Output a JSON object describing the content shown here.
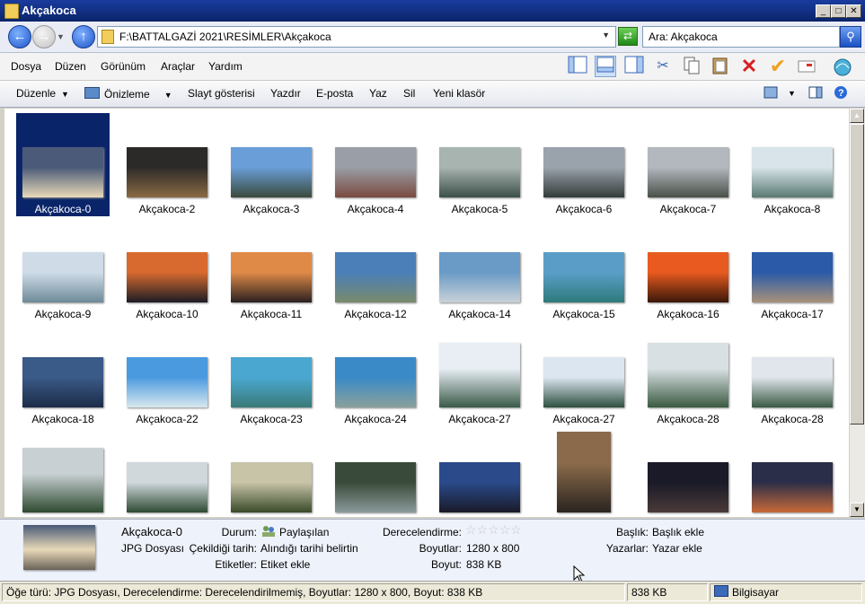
{
  "window": {
    "title": "Akçakoca"
  },
  "address": {
    "path": "F:\\BATTALGAZİ 2021\\RESİMLER\\Akçakoca",
    "search": "Ara: Akçakoca"
  },
  "menu": [
    "Dosya",
    "Düzen",
    "Görünüm",
    "Araçlar",
    "Yardım"
  ],
  "commands": {
    "organize": "Düzenle",
    "preview": "Önizleme",
    "slideshow": "Slayt gösterisi",
    "print": "Yazdır",
    "email": "E-posta",
    "burn": "Yaz",
    "delete": "Sil",
    "newfolder": "Yeni klasör"
  },
  "files": [
    {
      "name": "Akçakoca-0",
      "c1": "#4a5a78",
      "c2": "#e8d9b8",
      "selected": true
    },
    {
      "name": "Akçakoca-2",
      "c1": "#2c2a28",
      "c2": "#8a6a44"
    },
    {
      "name": "Akçakoca-3",
      "c1": "#6a9ed8",
      "c2": "#3a4a3c"
    },
    {
      "name": "Akçakoca-4",
      "c1": "#9a9ea6",
      "c2": "#7a4a40"
    },
    {
      "name": "Akçakoca-5",
      "c1": "#a8b4b0",
      "c2": "#3c5048"
    },
    {
      "name": "Akçakoca-6",
      "c1": "#9aa2ac",
      "c2": "#343c3a"
    },
    {
      "name": "Akçakoca-7",
      "c1": "#b2b8be",
      "c2": "#4a5048"
    },
    {
      "name": "Akçakoca-8",
      "c1": "#d8e4ea",
      "c2": "#5a7a72"
    },
    {
      "name": "Akçakoca-9",
      "c1": "#cfdce8",
      "c2": "#6e8a98"
    },
    {
      "name": "Akçakoca-10",
      "c1": "#d86a30",
      "c2": "#1c1c24"
    },
    {
      "name": "Akçakoca-11",
      "c1": "#e08a48",
      "c2": "#2a2020"
    },
    {
      "name": "Akçakoca-12",
      "c1": "#4a7fb8",
      "c2": "#7a8a6c"
    },
    {
      "name": "Akçakoca-14",
      "c1": "#6a9ac6",
      "c2": "#c8d2d8"
    },
    {
      "name": "Akçakoca-15",
      "c1": "#5a9ec8",
      "c2": "#2e7a7a"
    },
    {
      "name": "Akçakoca-16",
      "c1": "#e85a20",
      "c2": "#3a1808"
    },
    {
      "name": "Akçakoca-17",
      "c1": "#2a5aa8",
      "c2": "#a8927a"
    },
    {
      "name": "Akçakoca-18",
      "c1": "#3a5a88",
      "c2": "#1c2c48"
    },
    {
      "name": "Akçakoca-22",
      "c1": "#4a9ae0",
      "c2": "#d8e8ee"
    },
    {
      "name": "Akçakoca-23",
      "c1": "#4aa8d0",
      "c2": "#3a7a78"
    },
    {
      "name": "Akçakoca-24",
      "c1": "#3a8ac8",
      "c2": "#8aa09a"
    },
    {
      "name": "Akçakoca-27",
      "c1": "#e8eef4",
      "c2": "#3a5a48",
      "tall": true
    },
    {
      "name": "Akçakoca-27",
      "c1": "#dce6f0",
      "c2": "#2e5040"
    },
    {
      "name": "Akçakoca-28",
      "c1": "#d8e0e4",
      "c2": "#3a5a40",
      "tall": true
    },
    {
      "name": "Akçakoca-28",
      "c1": "#e0e6ec",
      "c2": "#3a5a44"
    },
    {
      "name": "",
      "c1": "#c8d0d4",
      "c2": "#2e4a30",
      "tall": true
    },
    {
      "name": "",
      "c1": "#d0d8dc",
      "c2": "#2e4a34"
    },
    {
      "name": "",
      "c1": "#c8c4a8",
      "c2": "#3a4a2a"
    },
    {
      "name": "",
      "c1": "#3a4a3a",
      "c2": "#8a9a9a"
    },
    {
      "name": "",
      "c1": "#2a4a8a",
      "c2": "#1a1a28"
    },
    {
      "name": "",
      "c1": "#8a6a4a",
      "c2": "#2a2420",
      "xtall": true
    },
    {
      "name": "",
      "c1": "#1a1a28",
      "c2": "#4a3a38"
    },
    {
      "name": "",
      "c1": "#2a2e48",
      "c2": "#c86a38"
    }
  ],
  "details": {
    "name": "Akçakoca-0",
    "type": "JPG Dosyası",
    "status_label": "Durum:",
    "status_value": "Paylaşılan",
    "date_label": "Çekildiği tarih:",
    "date_value": "Alındığı tarihi belirtin",
    "tags_label": "Etiketler:",
    "tags_value": "Etiket ekle",
    "rating_label": "Derecelendirme:",
    "dims_label": "Boyutlar:",
    "dims_value": "1280 x 800",
    "size_label": "Boyut:",
    "size_value": "838 KB",
    "title_label": "Başlık:",
    "title_value": "Başlık ekle",
    "authors_label": "Yazarlar:",
    "authors_value": "Yazar ekle"
  },
  "status": {
    "left": "Öğe türü: JPG Dosyası, Derecelendirme: Derecelendirilmemiş, Boyutlar: 1280 x 800, Boyut: 838 KB",
    "size": "838 KB",
    "computer": "Bilgisayar"
  }
}
